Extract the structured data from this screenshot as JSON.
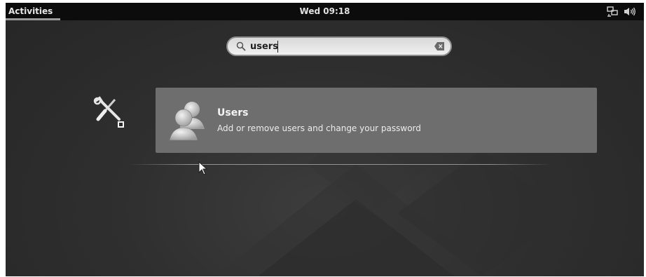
{
  "topbar": {
    "activities_label": "Activities",
    "clock": "Wed 09:18",
    "tray_icons": [
      "network-icon",
      "volume-icon"
    ]
  },
  "search": {
    "value": "users",
    "icon": "search-icon",
    "clear_icon": "clear-icon"
  },
  "app_icon": "settings-tools-icon",
  "results": [
    {
      "title": "Users",
      "description": "Add or remove users and change your password",
      "icon": "users-icon"
    }
  ],
  "colors": {
    "topbar_bg": "#0c0c0c",
    "result_bg": "#6e6e6e",
    "search_bg": "#ececec"
  }
}
